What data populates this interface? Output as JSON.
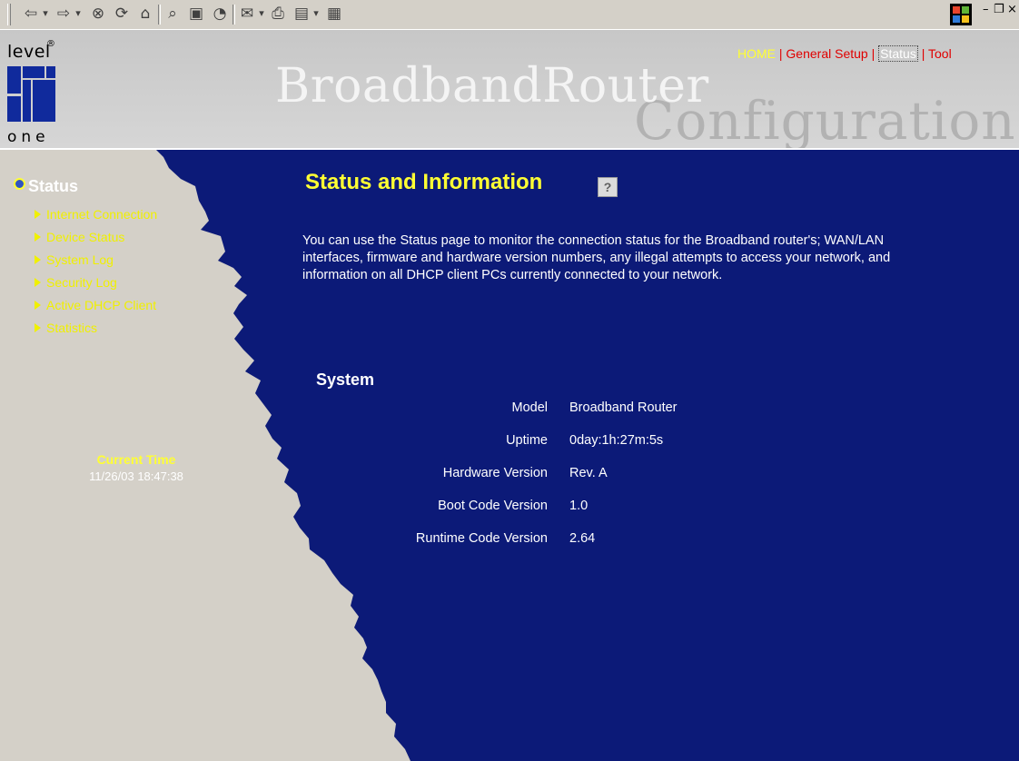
{
  "toolbar": {
    "back_icon": "arrow-left-icon",
    "forward_icon": "arrow-right-icon",
    "stop_icon": "stop-icon",
    "refresh_icon": "refresh-icon",
    "home_icon": "home-icon",
    "search_icon": "search-icon",
    "favorites_icon": "favorites-icon",
    "history_icon": "history-icon",
    "mail_icon": "mail-icon",
    "print_icon": "print-icon",
    "edit_icon": "edit-icon",
    "discuss_icon": "discuss-icon"
  },
  "header": {
    "logo_top": "level",
    "logo_bottom": "one",
    "brand": "BroadbandRouter",
    "subtitle": "Configuration",
    "nav": {
      "home": "HOME",
      "general_setup": "General Setup",
      "status": "Status",
      "tool": "Tool",
      "separator": "|"
    }
  },
  "sidebar": {
    "title": "Status",
    "items": [
      {
        "label": "Internet Connection"
      },
      {
        "label": "Device Status"
      },
      {
        "label": "System Log"
      },
      {
        "label": "Security Log"
      },
      {
        "label": "Active DHCP Client"
      },
      {
        "label": "Statistics"
      }
    ],
    "current_time_label": "Current Time",
    "current_time_value": "11/26/03 18:47:38"
  },
  "main": {
    "title": "Status and Information",
    "intro": "You can use the Status page to monitor the connection status for the Broadband router's; WAN/LAN interfaces, firmware and hardware version numbers, any illegal attempts to access your network, and information on all DHCP client PCs currently connected to your network.",
    "system": {
      "heading": "System",
      "rows": [
        {
          "key": "Model",
          "value": "Broadband Router"
        },
        {
          "key": "Uptime",
          "value": "0day:1h:27m:5s"
        },
        {
          "key": "Hardware Version",
          "value": "Rev. A"
        },
        {
          "key": "Boot Code Version",
          "value": "1.0"
        },
        {
          "key": "Runtime Code Version",
          "value": "2.64"
        }
      ]
    }
  },
  "colors": {
    "main_bg": "#0c1a78",
    "sidebar_bg": "#d4d0c8",
    "link_yellow": "#f0f000",
    "nav_red": "#e00000"
  }
}
